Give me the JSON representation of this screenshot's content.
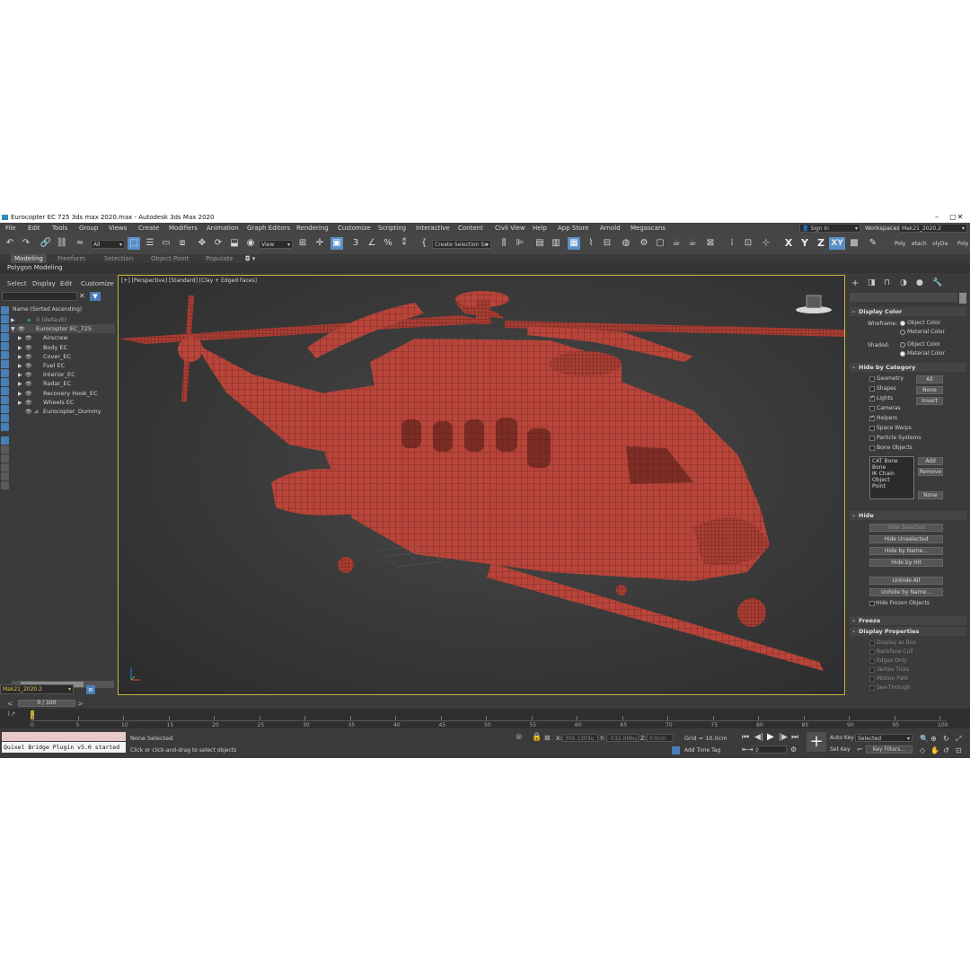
{
  "window": {
    "title": "Eurocopter EC 725 3ds max 2020.max - Autodesk 3ds Max 2020",
    "controls": [
      "–",
      "▢",
      "✕"
    ]
  },
  "menubar": {
    "items": [
      "File",
      "Edit",
      "Tools",
      "Group",
      "Views",
      "Create",
      "Modifiers",
      "Animation",
      "Graph Editors",
      "Rendering",
      "Customize",
      "Scripting",
      "Interactive",
      "Content",
      "Civil View",
      "Help",
      "App Store",
      "Arnold",
      "Megascans"
    ],
    "sign_in": "Sign In",
    "workspaces_label": "Workspaces:",
    "workspace_value": "Mak21_2020.2"
  },
  "toolbar": {
    "filter_value": "All",
    "view_value": "View",
    "selection_set_placeholder": "Create Selection Se",
    "axes": [
      "X",
      "Y",
      "Z",
      "XY"
    ],
    "poly_labels": [
      "Poly",
      "etach",
      "olyDa",
      "Poly"
    ]
  },
  "ribbon": {
    "tabs": [
      "Modeling",
      "Freeform",
      "Selection",
      "Object Paint",
      "Populate"
    ],
    "active_tab": "Modeling",
    "sub_label": "Polygon Modeling"
  },
  "explorer": {
    "menu": [
      "Select",
      "Display",
      "Edit",
      "Customize"
    ],
    "column_header": "Name (Sorted Ascending)",
    "rows": [
      {
        "label": "0 (default)",
        "indent": 0,
        "dim": true
      },
      {
        "label": "Eurocopter EC_725",
        "indent": 1,
        "dim": false
      },
      {
        "label": "Airscrew",
        "indent": 2,
        "dim": false
      },
      {
        "label": "Body EC",
        "indent": 2,
        "dim": false
      },
      {
        "label": "Cover_EC",
        "indent": 2,
        "dim": false
      },
      {
        "label": "Fuel EC",
        "indent": 2,
        "dim": false
      },
      {
        "label": "Interior_EC",
        "indent": 2,
        "dim": false
      },
      {
        "label": "Radar_EC",
        "indent": 2,
        "dim": false
      },
      {
        "label": "Recovery Hook_EC",
        "indent": 2,
        "dim": false
      },
      {
        "label": "Wheels EC",
        "indent": 2,
        "dim": false
      },
      {
        "label": "Eurocopter_Dummy",
        "indent": 2,
        "dim": false
      }
    ],
    "workspace_field": "Mak21_2020.2"
  },
  "viewport": {
    "label": "[+] [Perspective] [Standard] [Clay + Edged Faces]",
    "colors": {
      "mesh": "#b8453a",
      "wire": "#5a1a14",
      "frame": "#c8b43c"
    }
  },
  "command_panel": {
    "display_color": {
      "title": "Display Color",
      "wireframe_label": "Wireframe:",
      "shaded_label": "Shaded:",
      "object_color": "Object Color",
      "material_color": "Material Color"
    },
    "hide_by_category": {
      "title": "Hide by Category",
      "items": [
        {
          "label": "Geometry",
          "checked": false
        },
        {
          "label": "Shapes",
          "checked": false
        },
        {
          "label": "Lights",
          "checked": true
        },
        {
          "label": "Cameras",
          "checked": false
        },
        {
          "label": "Helpers",
          "checked": true
        },
        {
          "label": "Space Warps",
          "checked": false
        },
        {
          "label": "Particle Systems",
          "checked": false
        },
        {
          "label": "Bone Objects",
          "checked": false
        }
      ],
      "buttons": [
        "All",
        "None",
        "Invert"
      ],
      "list": [
        "CAT Bone",
        "Bone",
        "IK Chain Object",
        "Point"
      ],
      "list_buttons": [
        "Add",
        "Remove",
        "None"
      ]
    },
    "hide": {
      "title": "Hide",
      "buttons": [
        "Hide Selected",
        "Hide Unselected",
        "Hide by Name...",
        "Hide by Hit",
        "Unhide All",
        "Unhide by Name..."
      ],
      "disabled": [
        "Hide Selected"
      ],
      "hide_frozen": "Hide Frozen Objects"
    },
    "freeze": {
      "title": "Freeze"
    },
    "display_properties": {
      "title": "Display Properties",
      "items": [
        "Display as Box",
        "Backface Cull",
        "Edges Only",
        "Vertex Ticks",
        "Motion Path",
        "See-Through"
      ]
    }
  },
  "timeline": {
    "frame_display": "0 / 100",
    "ticks": [
      "0",
      "5",
      "10",
      "15",
      "20",
      "25",
      "30",
      "35",
      "40",
      "45",
      "50",
      "55",
      "60",
      "65",
      "70",
      "75",
      "80",
      "85",
      "90",
      "95",
      "100"
    ]
  },
  "status": {
    "quixel": "Quixel Bridge Plugin v5.0 started",
    "selection": "None Selected",
    "prompt": "Click or click-and-drag to select objects",
    "x_label": "X:",
    "x_value": "305.1303u",
    "y_label": "Y:",
    "y_value": "-532.066u",
    "z_label": "Z:",
    "z_value": "0.0cm",
    "grid": "Grid = 10.0cm",
    "add_time_tag": "Add Time Tag",
    "auto_key": "Auto Key",
    "set_key": "Set Key",
    "selected": "Selected",
    "key_filters": "Key Filters...",
    "frame_value": "0"
  }
}
